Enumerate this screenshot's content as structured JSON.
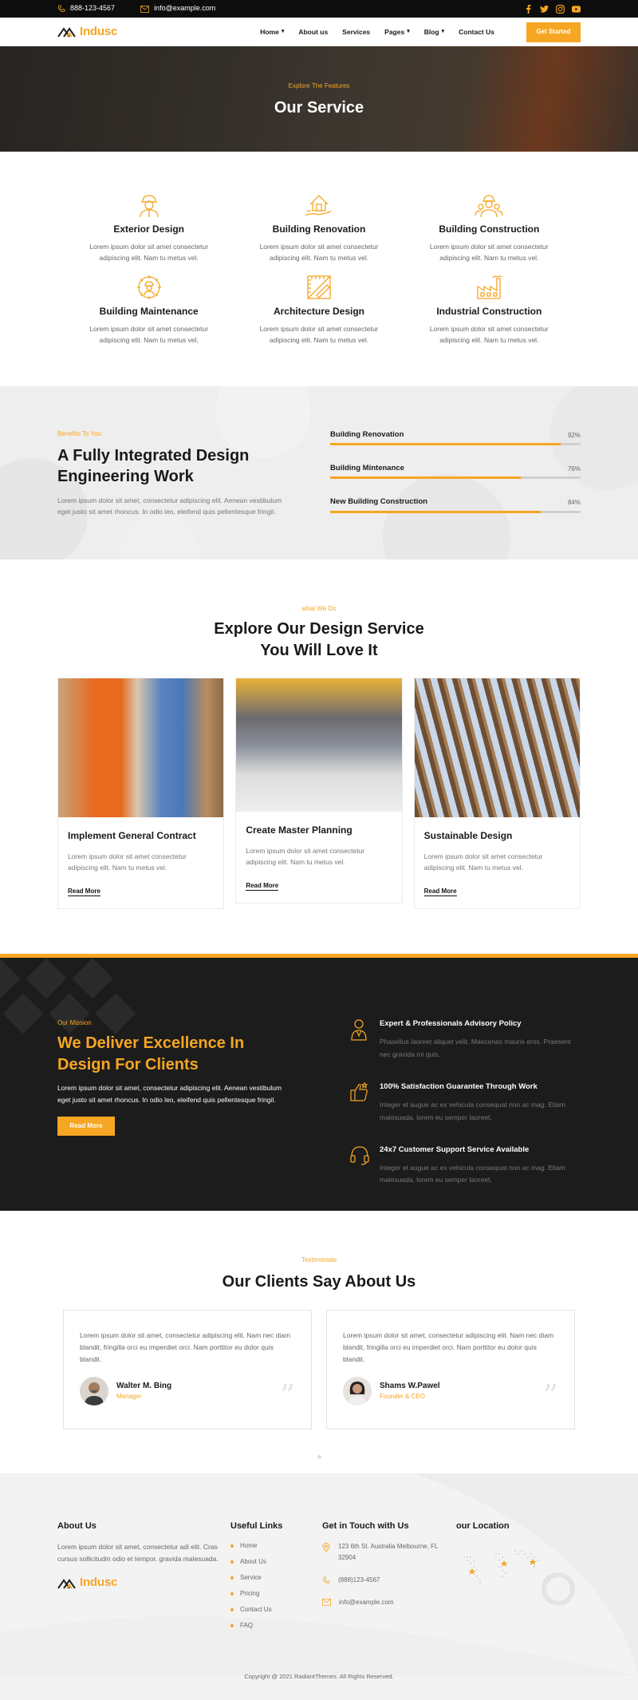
{
  "topbar": {
    "phone": "888-123-4567",
    "email": "info@example.com",
    "social": [
      "facebook-icon",
      "twitter-icon",
      "instagram-icon",
      "youtube-icon"
    ]
  },
  "nav": {
    "logo": "Indusc",
    "menu": [
      {
        "label": "Home",
        "caret": true
      },
      {
        "label": "About us",
        "caret": false
      },
      {
        "label": "Services",
        "caret": false
      },
      {
        "label": "Pages",
        "caret": true
      },
      {
        "label": "Blog",
        "caret": true
      },
      {
        "label": "Contact Us",
        "caret": false
      }
    ],
    "cta": "Get Started"
  },
  "hero": {
    "kicker": "Explore The Features",
    "title": "Our Service"
  },
  "features": [
    {
      "icon": "worker-icon",
      "title": "Exterior Design",
      "text": "Lorem ipsum dolor sit amet consectetur adipiscing elit. Nam tu metus vel."
    },
    {
      "icon": "house-hand-icon",
      "title": "Building Renovation",
      "text": "Lorem ipsum dolor sit amet consectetur adipiscing elit. Nam tu metus vel."
    },
    {
      "icon": "team-icon",
      "title": "Building Construction",
      "text": "Lorem ipsum dolor sit amet consectetur adipiscing elit. Nam tu metus vel."
    },
    {
      "icon": "gear-worker-icon",
      "title": "Building Maintenance",
      "text": "Lorem ipsum dolor sit amet consectetur adipiscing elit. Nam tu metus vel."
    },
    {
      "icon": "ruler-pencil-icon",
      "title": "Architecture Design",
      "text": "Lorem ipsum dolor sit amet consectetur adipiscing elit. Nam tu metus vel."
    },
    {
      "icon": "factory-icon",
      "title": "Industrial Construction",
      "text": "Lorem ipsum dolor sit amet consectetur adipiscing elit. Nam tu metus vel."
    }
  ],
  "benefits": {
    "kicker": "Benefits To You",
    "title": "A Fully Integrated Design Engineering Work",
    "text": "Lorem ipsum dolor sit amet, consectetur adipiscing elit. Aenean vestibulum eget justo sit amet rhoncus. In odio leo, eleifend quis pellentesque fringil.",
    "bars": [
      {
        "label": "Building Renovation",
        "percent": 92,
        "display": "92%"
      },
      {
        "label": "Building Mintenance",
        "percent": 76,
        "display": "76%"
      },
      {
        "label": "New Building Construction",
        "percent": 84,
        "display": "84%"
      }
    ]
  },
  "explore": {
    "kicker": "what We Do",
    "title_line1": "Explore Our Design Service",
    "title_line2": "You Will Love It",
    "cards": [
      {
        "title": "Implement General Contract",
        "text": "Lorem ipsum dolor sit amet consectetur adipiscing elit. Nam tu metus vel.",
        "link": "Read More"
      },
      {
        "title": "Create Master Planning",
        "text": "Lorem ipsum dolor sit amet consectetur adipiscing elit. Nam tu metus vel.",
        "link": "Read More"
      },
      {
        "title": "Sustainable Design",
        "text": "Lorem ipsum dolor sit amet consectetur adipiscing elit. Nam tu metus vel.",
        "link": "Read More"
      }
    ]
  },
  "mission": {
    "kicker": "Our Mission",
    "title": "We Deliver Excellence In Design For Clients",
    "text": "Lorem ipsum dolor sit amet, consectetur adipiscing elit. Aenean vestibulum eget justo sit amet rhoncus. In odio leo, eleifend quis pellentesque fringil.",
    "button": "Read More",
    "items": [
      {
        "icon": "advisor-icon",
        "title": "Expert & Professionals Advisory Policy",
        "text": "Phasellus laoreet aliquet velit. Maecenas mauris eros. Praesent nec gravida mi quis."
      },
      {
        "icon": "thumbs-up-icon",
        "title": "100% Satisfaction Guarantee Through Work",
        "text": "Integer et augue ac ex vehicula consequat non ac mag. Etiam malesuada, lorem eu semper laoreet."
      },
      {
        "icon": "headset-icon",
        "title": "24x7 Customer Support Service Available",
        "text": "Integer et augue ac ex vehicula consequat non ac mag. Etiam malesuada, lorem eu semper laoreet."
      }
    ]
  },
  "testimonials": {
    "kicker": "Testimonials",
    "title": "Our Clients Say About Us",
    "items": [
      {
        "text": "Lorem ipsum dolor sit amet, consectetur adipiscing elit. Nam nec diam blandit, fringilla orci eu imperdiet orci. Nam porttitor eu dolor quis blandit.",
        "name": "Walter M. Bing",
        "role": "Manager"
      },
      {
        "text": "Lorem ipsum dolor sit amet, consectetur adipiscing elit. Nam nec diam blandit, fringilla orci eu imperdiet orci. Nam porttitor eu dolor quis blandit.",
        "name": "Shams W.Pawel",
        "role": "Founder & CEO"
      }
    ]
  },
  "footer": {
    "about_title": "About Us",
    "about_text": "Lorem ipsum dolor sit amet, consectetur adi elit. Cras cursus sollicitudin odio et tempor. gravida malesuada.",
    "logo": "Indusc",
    "links_title": "Useful Links",
    "links": [
      "Home",
      "About Us",
      "Service",
      "Pricing",
      "Contact Us",
      "FAQ"
    ],
    "touch_title": "Get in Touch with Us",
    "address": "123 6th St. Australia Melbourne, FL 32904",
    "phone": "(888)123-4567",
    "email": "info@example.com",
    "location_title": "our Location",
    "copyright": "Copyright @ 2021 RadiantThemes. All Rights Reserved."
  },
  "colors": {
    "accent": "#f6a623",
    "dark": "#1c1c1c"
  }
}
